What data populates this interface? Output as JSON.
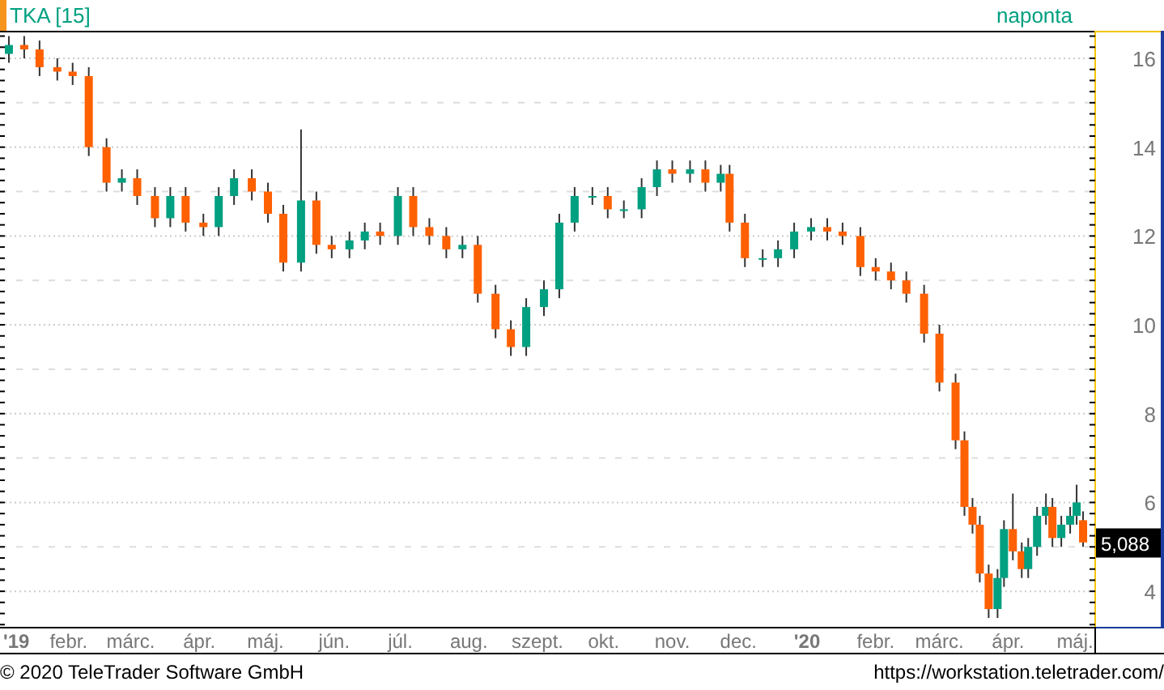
{
  "header": {
    "symbol": "TKA [15]",
    "interval": "naponta"
  },
  "chart": {
    "last_price": "5,088",
    "chart_data": {
      "type": "candlestick",
      "x": [
        2019.011,
        2019.03,
        2019.049,
        2019.071,
        2019.09,
        2019.11,
        2019.132,
        2019.151,
        2019.17,
        2019.192,
        2019.211,
        2019.23,
        2019.252,
        2019.271,
        2019.29,
        2019.312,
        2019.332,
        2019.351,
        2019.373,
        2019.392,
        2019.411,
        2019.433,
        2019.452,
        2019.471,
        2019.493,
        2019.512,
        2019.532,
        2019.553,
        2019.573,
        2019.592,
        2019.614,
        2019.633,
        2019.652,
        2019.674,
        2019.693,
        2019.712,
        2019.734,
        2019.753,
        2019.773,
        2019.795,
        2019.814,
        2019.833,
        2019.855,
        2019.874,
        2019.893,
        2019.904,
        2019.923,
        2019.945,
        2019.964,
        2019.984,
        2020.005,
        2020.025,
        2020.044,
        2020.066,
        2020.085,
        2020.104,
        2020.123,
        2020.145,
        2020.164,
        2020.184,
        2020.195,
        2020.205,
        2020.214,
        2020.225,
        2020.236,
        2020.244,
        2020.255,
        2020.266,
        2020.274,
        2020.285,
        2020.296,
        2020.304,
        2020.315,
        2020.326,
        2020.334,
        2020.342
      ],
      "ohlc": [
        [
          16.1,
          16.5,
          15.9,
          16.3
        ],
        [
          16.3,
          16.5,
          16.0,
          16.2
        ],
        [
          16.2,
          16.4,
          15.6,
          15.8
        ],
        [
          15.8,
          16.0,
          15.5,
          15.7
        ],
        [
          15.7,
          15.9,
          15.4,
          15.6
        ],
        [
          15.6,
          15.8,
          13.8,
          14.0
        ],
        [
          14.0,
          14.2,
          13.0,
          13.2
        ],
        [
          13.2,
          13.5,
          13.0,
          13.3
        ],
        [
          13.3,
          13.5,
          12.7,
          12.9
        ],
        [
          12.9,
          13.1,
          12.2,
          12.4
        ],
        [
          12.4,
          13.1,
          12.2,
          12.9
        ],
        [
          12.9,
          13.1,
          12.1,
          12.3
        ],
        [
          12.3,
          12.5,
          12.0,
          12.2
        ],
        [
          12.2,
          13.1,
          12.0,
          12.9
        ],
        [
          12.9,
          13.5,
          12.7,
          13.3
        ],
        [
          13.3,
          13.5,
          12.8,
          13.0
        ],
        [
          13.0,
          13.2,
          12.3,
          12.5
        ],
        [
          12.5,
          12.7,
          11.2,
          11.4
        ],
        [
          11.4,
          14.4,
          11.2,
          12.8
        ],
        [
          12.8,
          13.0,
          11.6,
          11.8
        ],
        [
          11.8,
          12.0,
          11.5,
          11.7
        ],
        [
          11.7,
          12.1,
          11.5,
          11.9
        ],
        [
          11.9,
          12.3,
          11.7,
          12.1
        ],
        [
          12.1,
          12.3,
          11.8,
          12.0
        ],
        [
          12.0,
          13.1,
          11.8,
          12.9
        ],
        [
          12.9,
          13.1,
          12.0,
          12.2
        ],
        [
          12.2,
          12.4,
          11.8,
          12.0
        ],
        [
          12.0,
          12.2,
          11.5,
          11.7
        ],
        [
          11.7,
          12.0,
          11.5,
          11.8
        ],
        [
          11.8,
          12.0,
          10.5,
          10.7
        ],
        [
          10.7,
          10.9,
          9.7,
          9.9
        ],
        [
          9.9,
          10.1,
          9.3,
          9.5
        ],
        [
          9.5,
          10.6,
          9.3,
          10.4
        ],
        [
          10.4,
          11.0,
          10.2,
          10.8
        ],
        [
          10.8,
          12.5,
          10.6,
          12.3
        ],
        [
          12.3,
          13.1,
          12.1,
          12.9
        ],
        [
          12.9,
          13.1,
          12.7,
          12.9
        ],
        [
          12.9,
          13.1,
          12.4,
          12.6
        ],
        [
          12.6,
          12.8,
          12.4,
          12.6
        ],
        [
          12.6,
          13.3,
          12.4,
          13.1
        ],
        [
          13.1,
          13.7,
          12.9,
          13.5
        ],
        [
          13.5,
          13.7,
          13.2,
          13.4
        ],
        [
          13.4,
          13.7,
          13.2,
          13.5
        ],
        [
          13.5,
          13.7,
          13.0,
          13.2
        ],
        [
          13.2,
          13.6,
          13.0,
          13.4
        ],
        [
          13.4,
          13.6,
          12.1,
          12.3
        ],
        [
          12.3,
          12.5,
          11.3,
          11.5
        ],
        [
          11.5,
          11.7,
          11.3,
          11.5
        ],
        [
          11.5,
          11.9,
          11.3,
          11.7
        ],
        [
          11.7,
          12.3,
          11.5,
          12.1
        ],
        [
          12.1,
          12.4,
          11.9,
          12.2
        ],
        [
          12.2,
          12.4,
          11.9,
          12.1
        ],
        [
          12.1,
          12.3,
          11.8,
          12.0
        ],
        [
          12.0,
          12.2,
          11.1,
          11.3
        ],
        [
          11.3,
          11.5,
          11.0,
          11.2
        ],
        [
          11.2,
          11.4,
          10.8,
          11.0
        ],
        [
          11.0,
          11.2,
          10.5,
          10.7
        ],
        [
          10.7,
          10.9,
          9.6,
          9.8
        ],
        [
          9.8,
          10.0,
          8.5,
          8.7
        ],
        [
          8.7,
          8.9,
          7.2,
          7.4
        ],
        [
          7.4,
          7.6,
          5.7,
          5.9
        ],
        [
          5.9,
          6.1,
          5.3,
          5.5
        ],
        [
          5.5,
          5.7,
          4.2,
          4.4
        ],
        [
          4.4,
          4.6,
          3.4,
          3.6
        ],
        [
          3.6,
          4.5,
          3.4,
          4.3
        ],
        [
          4.3,
          5.6,
          4.1,
          5.4
        ],
        [
          5.4,
          6.2,
          4.7,
          4.9
        ],
        [
          4.9,
          5.1,
          4.3,
          4.5
        ],
        [
          4.5,
          5.2,
          4.3,
          5.0
        ],
        [
          5.0,
          5.9,
          4.8,
          5.7
        ],
        [
          5.7,
          6.2,
          5.5,
          5.9
        ],
        [
          5.9,
          6.1,
          5.0,
          5.2
        ],
        [
          5.2,
          5.7,
          5.0,
          5.5
        ],
        [
          5.5,
          5.9,
          5.3,
          5.7
        ],
        [
          5.7,
          6.4,
          5.5,
          6.0
        ],
        [
          5.6,
          5.8,
          5.0,
          5.1
        ]
      ],
      "xlim": [
        2019,
        2020.356
      ],
      "ylim": [
        3.2,
        16.62
      ],
      "xticks": [
        {
          "value": 2019,
          "label": "'19"
        },
        {
          "value": 2019.085,
          "label": "febr."
        },
        {
          "value": 2019.162,
          "label": "márc."
        },
        {
          "value": 2019.247,
          "label": "ápr."
        },
        {
          "value": 2019.329,
          "label": "máj."
        },
        {
          "value": 2019.414,
          "label": "jún."
        },
        {
          "value": 2019.496,
          "label": "júl."
        },
        {
          "value": 2019.581,
          "label": "aug."
        },
        {
          "value": 2019.666,
          "label": "szept."
        },
        {
          "value": 2019.748,
          "label": "okt."
        },
        {
          "value": 2019.833,
          "label": "nov."
        },
        {
          "value": 2019.915,
          "label": "dec."
        },
        {
          "value": 2020,
          "label": "'20"
        },
        {
          "value": 2020.085,
          "label": "febr."
        },
        {
          "value": 2020.164,
          "label": "márc."
        },
        {
          "value": 2020.249,
          "label": "ápr."
        },
        {
          "value": 2020.332,
          "label": "máj."
        }
      ],
      "yticks": [
        4,
        6,
        8,
        10,
        12,
        14,
        16
      ],
      "grid": true
    }
  },
  "footer": {
    "copyright": "© 2020 TeleTrader Software GmbH",
    "url": "https://workstation.teletrader.com/"
  }
}
